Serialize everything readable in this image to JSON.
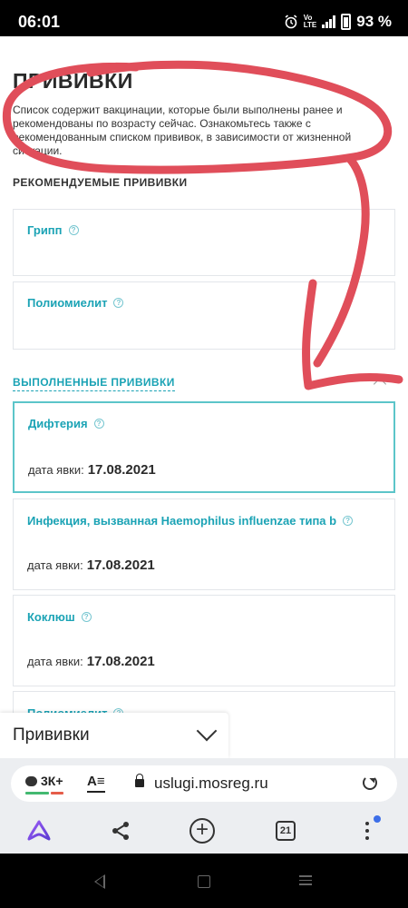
{
  "status_bar": {
    "time": "06:01",
    "network_top": "Vo",
    "network_bottom": "LTE",
    "battery": "93 %"
  },
  "page": {
    "title": "ПРИВИВКИ",
    "description": "Список содержит вакцинации, которые были выполнены ранее и рекомендованы по возрасту сейчас. Ознакомьтесь также с рекомендованным списком прививок, в зависимости от жизненной ситуации.",
    "recommended_section": {
      "title": "РЕКОМЕНДУЕМЫЕ ПРИВИВКИ",
      "items": [
        {
          "name": "Грипп"
        },
        {
          "name": "Полиомиелит"
        }
      ]
    },
    "completed_section": {
      "title": "ВЫПОЛНЕННЫЕ ПРИВИВКИ",
      "date_label": "дата явки:",
      "items": [
        {
          "name": "Дифтерия",
          "date": "17.08.2021"
        },
        {
          "name": "Инфекция, вызванная Haemophilus influenzae типа b",
          "date": "17.08.2021"
        },
        {
          "name": "Коклюш",
          "date": "17.08.2021"
        },
        {
          "name": "Полиомиелит",
          "date": ""
        }
      ]
    },
    "annotation_color": "#e04e5a",
    "accent_color": "#1ba3b5"
  },
  "find_bar": {
    "text": "Прививки"
  },
  "browser": {
    "comments_count": "3К+",
    "reader_label": "A≡",
    "url": "uslugi.mosreg.ru",
    "tabs_count": "21"
  }
}
